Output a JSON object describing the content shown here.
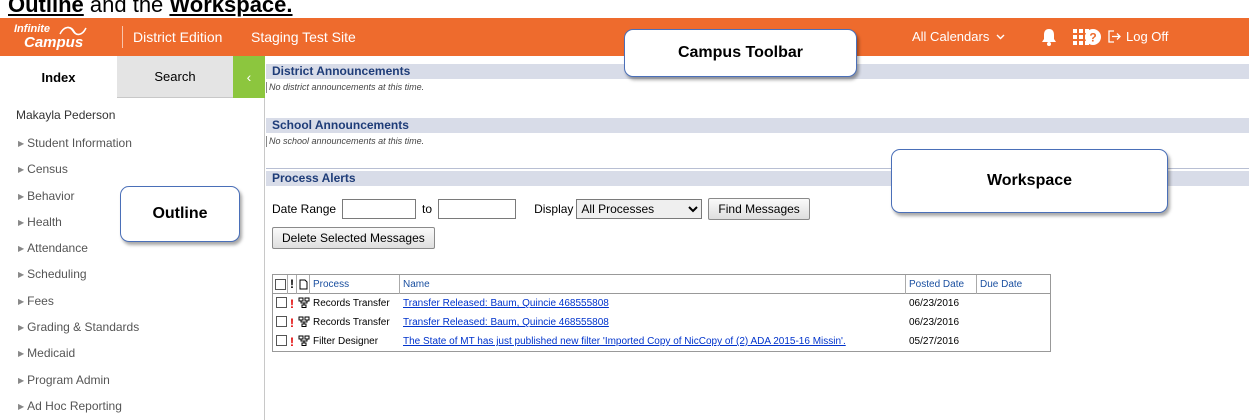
{
  "caption": {
    "part1": "Outline",
    "part2": " and the ",
    "part3": "Workspace."
  },
  "toolbar": {
    "logo_line1": "Infinite",
    "logo_line2": "Campus",
    "edition": "District Edition",
    "site": "Staging Test Site",
    "calendar_label": "All Calendars",
    "logoff_label": "Log Off",
    "color": "#ee6b2d"
  },
  "callouts": {
    "toolbar": "Campus Toolbar",
    "outline": "Outline",
    "workspace": "Workspace"
  },
  "nav": {
    "tabs": {
      "index": "Index",
      "search": "Search",
      "collapse": "‹"
    },
    "user": "Makayla Pederson",
    "items": [
      "Student Information",
      "Census",
      "Behavior",
      "Health",
      "Attendance",
      "Scheduling",
      "Fees",
      "Grading & Standards",
      "Medicaid",
      "Program Admin",
      "Ad Hoc Reporting"
    ]
  },
  "workspace": {
    "district": {
      "title": "District Announcements",
      "note": "No district announcements at this time."
    },
    "school": {
      "title": "School Announcements",
      "note": "No school announcements at this time."
    },
    "alerts": {
      "title": "Process Alerts",
      "date_range_label": "Date Range",
      "to_label": "to",
      "display_label": "Display",
      "display_value": "All Processes",
      "find_button": "Find Messages",
      "delete_button": "Delete Selected Messages",
      "columns": {
        "process": "Process",
        "name": "Name",
        "posted": "Posted Date",
        "due": "Due Date"
      },
      "rows": [
        {
          "process": "Records Transfer",
          "name": "Transfer Released: Baum, Quincie 468555808",
          "posted": "06/23/2016",
          "due": ""
        },
        {
          "process": "Records Transfer",
          "name": "Transfer Released: Baum, Quincie 468555808",
          "posted": "06/23/2016",
          "due": ""
        },
        {
          "process": "Filter Designer",
          "name": "The State of MT has just published new filter 'Imported Copy of NicCopy of (2) ADA 2015-16 Missin'.",
          "posted": "05/27/2016",
          "due": ""
        }
      ]
    }
  }
}
